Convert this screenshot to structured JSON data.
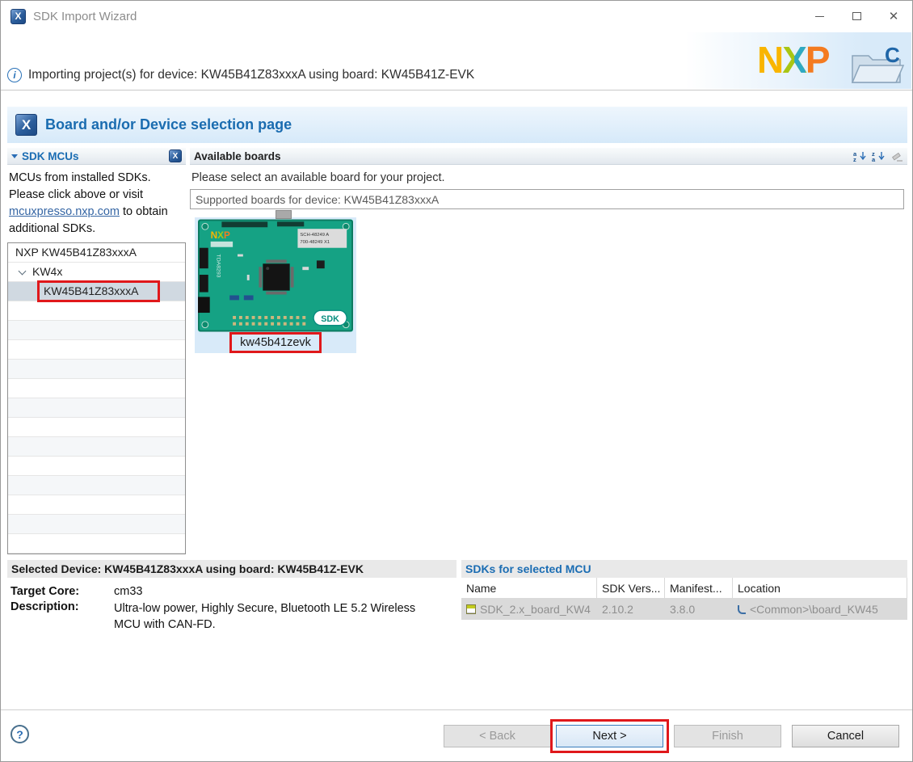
{
  "window": {
    "title": "SDK Import Wizard"
  },
  "icons": {
    "x_letter": "X",
    "close_glyph": "✕",
    "info_glyph": "i",
    "help_glyph": "?",
    "folder_letter": "C"
  },
  "logo": {
    "n": "N",
    "x": "X",
    "p": "P"
  },
  "header": {
    "message": "Importing project(s) for device: KW45B41Z83xxxA using board: KW45B41Z-EVK"
  },
  "page": {
    "title": "Board and/or Device selection page"
  },
  "sdk_mcus": {
    "title": "SDK MCUs",
    "desc_part1": "MCUs from installed SDKs. Please click above or visit ",
    "link_text": "mcuxpresso.nxp.com",
    "desc_part2": " to obtain additional SDKs.",
    "tree": {
      "root": "NXP KW45B41Z83xxxA",
      "group": "KW4x",
      "selected_mcu": "KW45B41Z83xxxA"
    }
  },
  "boards": {
    "title": "Available boards",
    "instruction": "Please select an available board for your project.",
    "filter_value": "Supported boards for device: KW45B41Z83xxxA",
    "board": {
      "label": "kw45b41zevk",
      "badge": "SDK",
      "sticker_line1": "SCH-48249 A",
      "sticker_line2": "700-48249 X1",
      "side_text": "TDA8293"
    }
  },
  "selected_device": {
    "header": "Selected Device: KW45B41Z83xxxA using board: KW45B41Z-EVK",
    "target_core_label": "Target Core:",
    "target_core_value": "cm33",
    "description_label": "Description:",
    "description_value": "Ultra-low power, Highly Secure, Bluetooth LE 5.2 Wireless MCU with CAN-FD."
  },
  "sdk_table": {
    "title": "SDKs for selected MCU",
    "columns": [
      "Name",
      "SDK Vers...",
      "Manifest...",
      "Location"
    ],
    "row": {
      "name": "SDK_2.x_board_KW4",
      "version": "2.10.2",
      "manifest": "3.8.0",
      "location": "<Common>\\board_KW45"
    }
  },
  "footer": {
    "back": "< Back",
    "next": "Next >",
    "finish": "Finish",
    "cancel": "Cancel"
  },
  "sort_icon_letters": {
    "a": "a",
    "z": "z"
  },
  "colors": {
    "accent_blue": "#1b6db3",
    "annotation_red": "#e0181b",
    "pcb_green": "#15a284"
  }
}
